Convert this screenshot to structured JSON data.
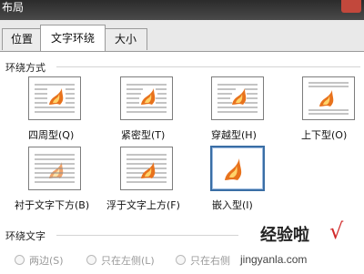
{
  "window": {
    "title": "布局"
  },
  "tabs": [
    {
      "label": "位置",
      "active": false
    },
    {
      "label": "文字环绕",
      "active": true
    },
    {
      "label": "大小",
      "active": false
    }
  ],
  "wrap_section": {
    "title": "环绕方式"
  },
  "wrap_options": [
    {
      "label": "四周型(Q)",
      "selected": false
    },
    {
      "label": "紧密型(T)",
      "selected": false
    },
    {
      "label": "穿越型(H)",
      "selected": false
    },
    {
      "label": "上下型(O)",
      "selected": false
    },
    {
      "label": "衬于文字下方(B)",
      "selected": false
    },
    {
      "label": "浮于文字上方(F)",
      "selected": false
    },
    {
      "label": "嵌入型(I)",
      "selected": true
    }
  ],
  "wrap_text_section": {
    "title": "环绕文字",
    "options": [
      "两边(S)",
      "只在左侧(L)",
      "只在右侧"
    ]
  },
  "watermark": {
    "text": "经验啦",
    "check": "√",
    "url": "jingyanla.com"
  },
  "colors": {
    "selection": "#3a6ea5",
    "flame": "#e8721c",
    "close": "#c2483c"
  }
}
